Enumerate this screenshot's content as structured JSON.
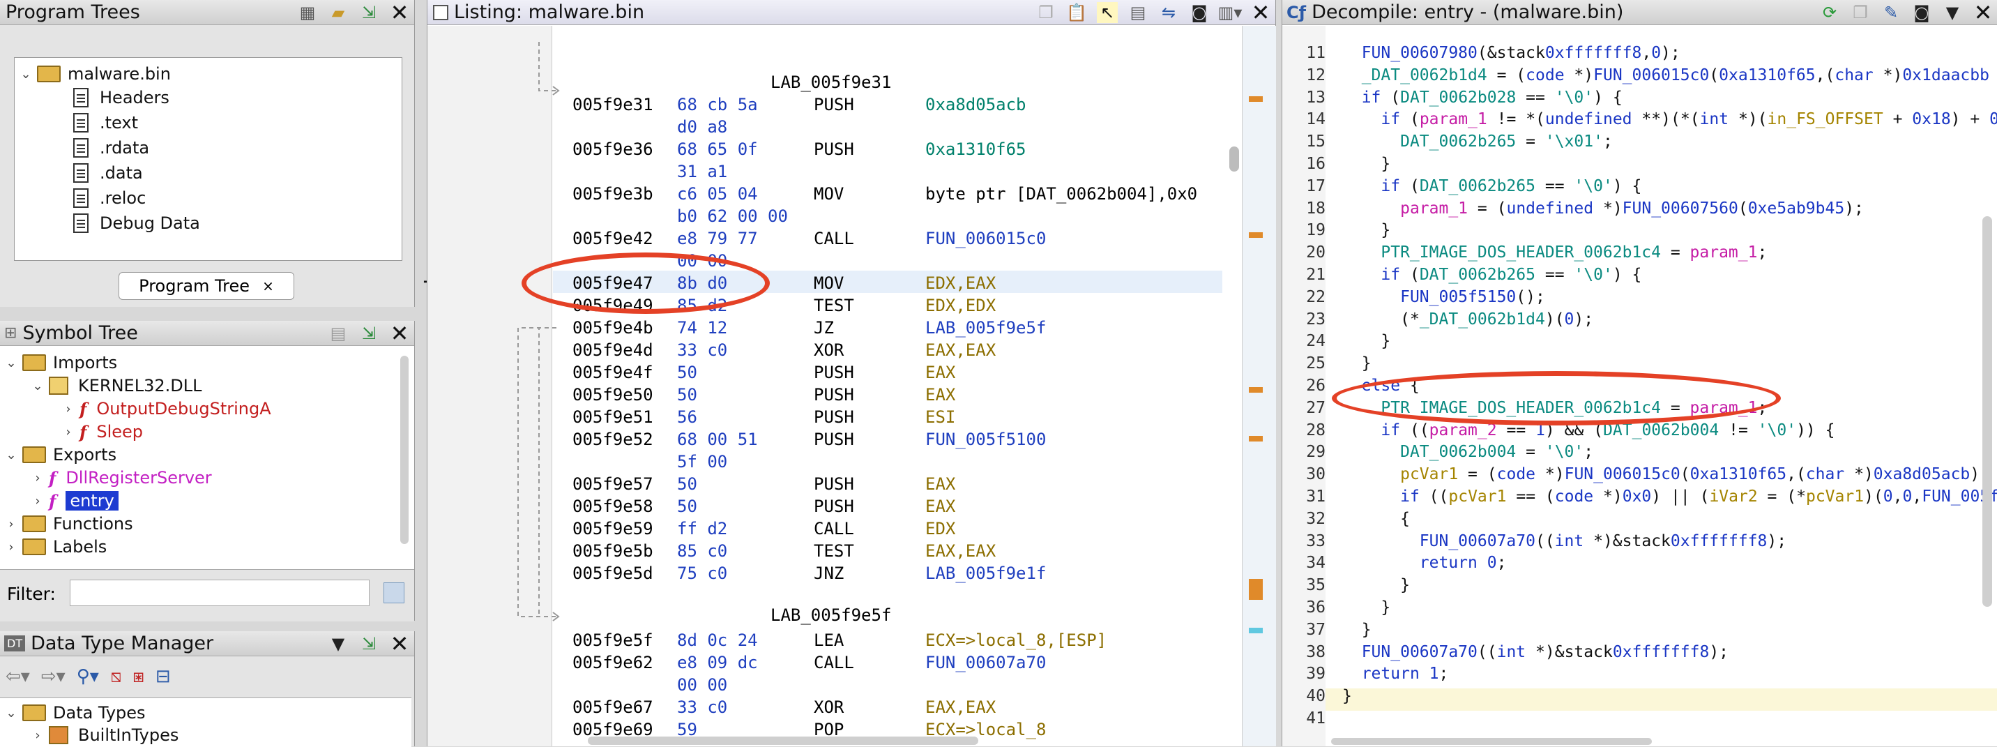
{
  "program_trees": {
    "title": "Program Trees",
    "root": "malware.bin",
    "sections": [
      "Headers",
      ".text",
      ".rdata",
      ".data",
      ".reloc",
      "Debug Data"
    ],
    "tab_label": "Program Tree",
    "tab_close": "×"
  },
  "symbol_tree": {
    "title": "Symbol Tree",
    "imports": "Imports",
    "dll": "KERNEL32.DLL",
    "import_funcs": [
      "OutputDebugStringA",
      "Sleep"
    ],
    "exports": "Exports",
    "export_funcs": [
      "DllRegisterServer",
      "entry"
    ],
    "functions": "Functions",
    "labels": "Labels",
    "filter_label": "Filter:",
    "filter_value": ""
  },
  "data_type_manager": {
    "title": "Data Type Manager",
    "root": "Data Types",
    "child": "BuiltInTypes"
  },
  "listing": {
    "title": "Listing:  malware.bin",
    "label1": "LAB_005f9e31",
    "label2": "LAB_005f9e5f",
    "rows": [
      {
        "addr": "005f9e31",
        "bytes": "68 cb 5a",
        "mnem": "PUSH",
        "op": "0xa8d05acb"
      },
      {
        "addr": "",
        "bytes": "d0 a8",
        "mnem": "",
        "op": ""
      },
      {
        "addr": "005f9e36",
        "bytes": "68 65 0f",
        "mnem": "PUSH",
        "op": "0xa1310f65"
      },
      {
        "addr": "",
        "bytes": "31 a1",
        "mnem": "",
        "op": ""
      },
      {
        "addr": "005f9e3b",
        "bytes": "c6 05 04",
        "mnem": "MOV",
        "op": "byte ptr [DAT_0062b004],0x0"
      },
      {
        "addr": "",
        "bytes": "b0 62 00 00",
        "mnem": "",
        "op": ""
      },
      {
        "addr": "005f9e42",
        "bytes": "e8 79 77",
        "mnem": "CALL",
        "op": "FUN_006015c0"
      },
      {
        "addr": "",
        "bytes": "00 00",
        "mnem": "",
        "op": ""
      },
      {
        "addr": "005f9e47",
        "bytes": "8b d0",
        "mnem": "MOV",
        "op": "EDX,EAX"
      },
      {
        "addr": "005f9e49",
        "bytes": "85 d2",
        "mnem": "TEST",
        "op": "EDX,EDX"
      },
      {
        "addr": "005f9e4b",
        "bytes": "74 12",
        "mnem": "JZ",
        "op": "LAB_005f9e5f"
      },
      {
        "addr": "005f9e4d",
        "bytes": "33 c0",
        "mnem": "XOR",
        "op": "EAX,EAX"
      },
      {
        "addr": "005f9e4f",
        "bytes": "50",
        "mnem": "PUSH",
        "op": "EAX"
      },
      {
        "addr": "005f9e50",
        "bytes": "50",
        "mnem": "PUSH",
        "op": "EAX"
      },
      {
        "addr": "005f9e51",
        "bytes": "56",
        "mnem": "PUSH",
        "op": "ESI"
      },
      {
        "addr": "005f9e52",
        "bytes": "68 00 51",
        "mnem": "PUSH",
        "op": "FUN_005f5100"
      },
      {
        "addr": "",
        "bytes": "5f 00",
        "mnem": "",
        "op": ""
      },
      {
        "addr": "005f9e57",
        "bytes": "50",
        "mnem": "PUSH",
        "op": "EAX"
      },
      {
        "addr": "005f9e58",
        "bytes": "50",
        "mnem": "PUSH",
        "op": "EAX"
      },
      {
        "addr": "005f9e59",
        "bytes": "ff d2",
        "mnem": "CALL",
        "op": "EDX"
      },
      {
        "addr": "005f9e5b",
        "bytes": "85 c0",
        "mnem": "TEST",
        "op": "EAX,EAX"
      },
      {
        "addr": "005f9e5d",
        "bytes": "75 c0",
        "mnem": "JNZ",
        "op": "LAB_005f9e1f"
      },
      {
        "addr": "005f9e5f",
        "bytes": "8d 0c 24",
        "mnem": "LEA",
        "op": "ECX=>local_8,[ESP]"
      },
      {
        "addr": "005f9e62",
        "bytes": "e8 09 dc",
        "mnem": "CALL",
        "op": "FUN_00607a70"
      },
      {
        "addr": "",
        "bytes": "00 00",
        "mnem": "",
        "op": ""
      },
      {
        "addr": "005f9e67",
        "bytes": "33 c0",
        "mnem": "XOR",
        "op": "EAX,EAX"
      },
      {
        "addr": "005f9e69",
        "bytes": "59",
        "mnem": "POP",
        "op": "ECX=>local_8"
      }
    ]
  },
  "decompile": {
    "title": "Decompile: entry -  (malware.bin)",
    "lines": [
      {
        "n": "11",
        "c": "  FUN_00607980(&stack0xfffffff8,0);"
      },
      {
        "n": "12",
        "c": "  _DAT_0062b1d4 = (code *)FUN_006015c0(0xa1310f65,(char *)0x1daacbb"
      },
      {
        "n": "13",
        "c": "  if (DAT_0062b028 == '\\0') {"
      },
      {
        "n": "14",
        "c": "    if (param_1 != *(undefined **)(*(int *)(in_FS_OFFSET + 0x18) + 0"
      },
      {
        "n": "15",
        "c": "      DAT_0062b265 = '\\x01';"
      },
      {
        "n": "16",
        "c": "    }"
      },
      {
        "n": "17",
        "c": "    if (DAT_0062b265 == '\\0') {"
      },
      {
        "n": "18",
        "c": "      param_1 = (undefined *)FUN_00607560(0xe5ab9b45);"
      },
      {
        "n": "19",
        "c": "    }"
      },
      {
        "n": "20",
        "c": "    PTR_IMAGE_DOS_HEADER_0062b1c4 = param_1;"
      },
      {
        "n": "21",
        "c": "    if (DAT_0062b265 == '\\0') {"
      },
      {
        "n": "22",
        "c": "      FUN_005f5150();"
      },
      {
        "n": "23",
        "c": "      (*_DAT_0062b1d4)(0);"
      },
      {
        "n": "24",
        "c": "    }"
      },
      {
        "n": "25",
        "c": "  }"
      },
      {
        "n": "26",
        "c": "  else {"
      },
      {
        "n": "27",
        "c": "    PTR_IMAGE_DOS_HEADER_0062b1c4 = param_1;"
      },
      {
        "n": "28",
        "c": "    if ((param_2 == 1) && (DAT_0062b004 != '\\0')) {"
      },
      {
        "n": "29",
        "c": "      DAT_0062b004 = '\\0';"
      },
      {
        "n": "30",
        "c": "      pcVar1 = (code *)FUN_006015c0(0xa1310f65,(char *)0xa8d05acb);"
      },
      {
        "n": "31",
        "c": "      if ((pcVar1 == (code *)0x0) || (iVar2 = (*pcVar1)(0,0,FUN_005f"
      },
      {
        "n": "32",
        "c": "      {"
      },
      {
        "n": "33",
        "c": "        FUN_00607a70((int *)&stack0xfffffff8);"
      },
      {
        "n": "34",
        "c": "        return 0;"
      },
      {
        "n": "35",
        "c": "      }"
      },
      {
        "n": "36",
        "c": "    }"
      },
      {
        "n": "37",
        "c": "  }"
      },
      {
        "n": "38",
        "c": "  FUN_00607a70((int *)&stack0xfffffff8);"
      },
      {
        "n": "39",
        "c": "  return 1;"
      },
      {
        "n": "40",
        "c": "}"
      },
      {
        "n": "41",
        "c": ""
      }
    ]
  },
  "colors": {
    "annotation": "#e44126",
    "keyword": "#1a36c4",
    "global": "#0a8a80",
    "param": "#c51ca5"
  }
}
